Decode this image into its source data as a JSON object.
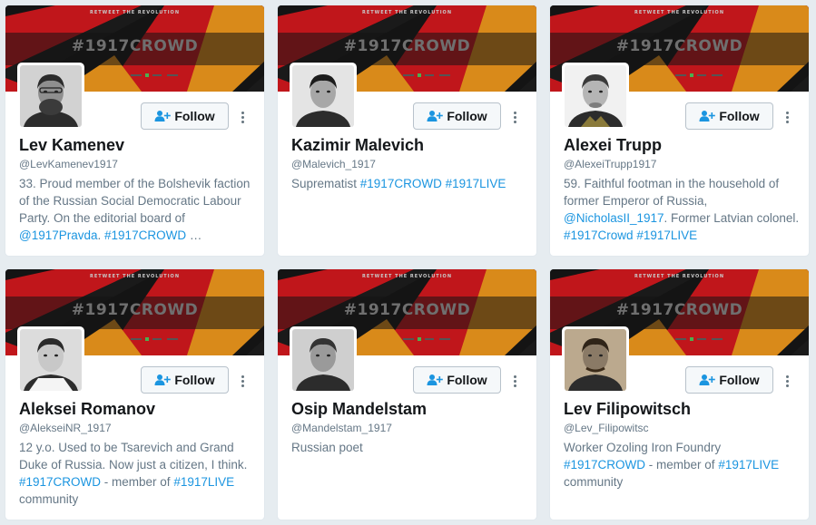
{
  "accent_color": "#1b95e0",
  "follow_icon": "follow-user-plus-icon",
  "more_icon": "more-vertical-icon",
  "banner": {
    "tagline": "RETWEET THE REVOLUTION",
    "hashtag": "#1917CROWD"
  },
  "cards": [
    {
      "name": "Lev Kamenev",
      "handle": "@LevKamenev1917",
      "follow_label": "Follow",
      "bio": [
        {
          "text": "33. Proud member of the Bolshevik faction of the Russian Social Democratic Labour Party. On the editorial board of "
        },
        {
          "text": "@1917Pravda",
          "link": true
        },
        {
          "text": ". "
        },
        {
          "text": "#1917CROWD",
          "link": true
        },
        {
          "text": " …"
        }
      ]
    },
    {
      "name": "Kazimir Malevich",
      "handle": "@Malevich_1917",
      "follow_label": "Follow",
      "bio": [
        {
          "text": "Suprematist "
        },
        {
          "text": "#1917CROWD",
          "link": true
        },
        {
          "text": " "
        },
        {
          "text": "#1917LIVE",
          "link": true
        }
      ]
    },
    {
      "name": "Alexei Trupp",
      "handle": "@AlexeiTrupp1917",
      "follow_label": "Follow",
      "bio": [
        {
          "text": "59. Faithful footman in the household of former Emperor of Russia, "
        },
        {
          "text": "@NicholasII_1917",
          "link": true
        },
        {
          "text": ". Former Latvian colonel. "
        },
        {
          "text": "#1917Crowd",
          "link": true
        },
        {
          "text": " "
        },
        {
          "text": "#1917LIVE",
          "link": true
        }
      ]
    },
    {
      "name": "Aleksei Romanov",
      "handle": "@AlekseiNR_1917",
      "follow_label": "Follow",
      "bio": [
        {
          "text": "12 y.o. Used to be Tsarevich and Grand Duke of Russia. Now just a citizen, I think. "
        },
        {
          "text": "#1917CROWD",
          "link": true
        },
        {
          "text": " - member of "
        },
        {
          "text": "#1917LIVE",
          "link": true
        },
        {
          "text": " community"
        }
      ]
    },
    {
      "name": "Osip Mandelstam",
      "handle": "@Mandelstam_1917",
      "follow_label": "Follow",
      "bio": [
        {
          "text": "Russian poet"
        }
      ]
    },
    {
      "name": "Lev Filipowitsch",
      "handle": "@Lev_Filipowitsc",
      "follow_label": "Follow",
      "bio": [
        {
          "text": "Worker Ozoling Iron Foundry "
        },
        {
          "text": "#1917CROWD",
          "link": true
        },
        {
          "text": " - member of "
        },
        {
          "text": "#1917LIVE",
          "link": true
        },
        {
          "text": " community"
        }
      ]
    }
  ]
}
